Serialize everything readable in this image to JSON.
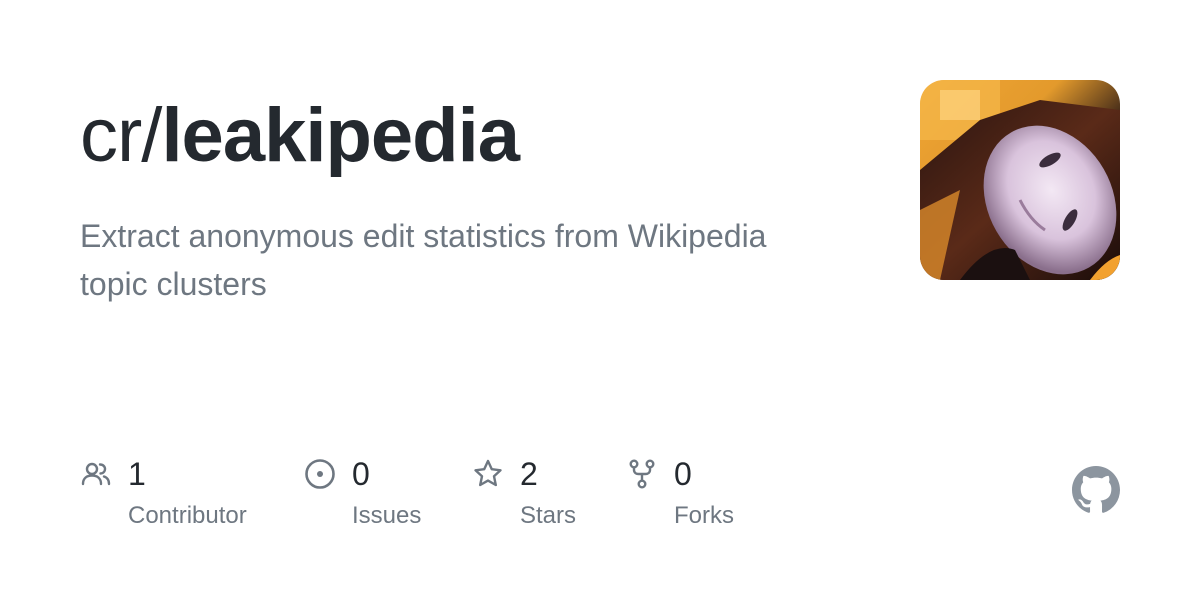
{
  "repo": {
    "owner_prefix": "cr/",
    "name": "leakipedia",
    "description": "Extract anonymous edit statistics from Wikipedia topic clusters"
  },
  "avatar": {
    "icon": "avatar-photo"
  },
  "stats": [
    {
      "icon": "people-icon",
      "count": "1",
      "label": "Contributor"
    },
    {
      "icon": "issue-icon",
      "count": "0",
      "label": "Issues"
    },
    {
      "icon": "star-icon",
      "count": "2",
      "label": "Stars"
    },
    {
      "icon": "fork-icon",
      "count": "0",
      "label": "Forks"
    }
  ],
  "branding": {
    "logo": "github-logo-icon"
  },
  "colors": {
    "title": "#24292f",
    "muted": "#6e7781",
    "icon": "#6e7781",
    "logo": "#8c959f"
  }
}
